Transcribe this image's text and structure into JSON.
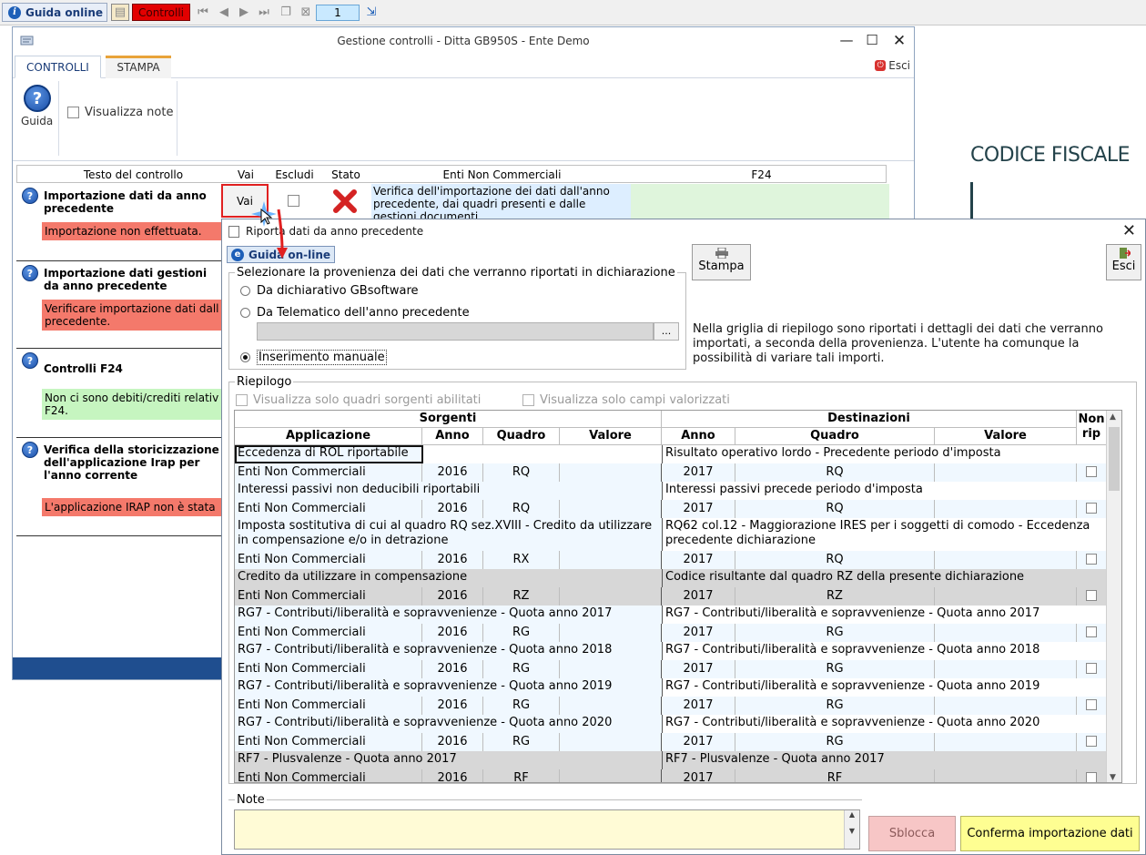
{
  "topbar": {
    "guida_label": "Guida online",
    "controlli_label": "Controlli",
    "page_number": "1"
  },
  "gestione": {
    "title": "Gestione controlli - Ditta GB950S - Ente Demo",
    "tab_controlli": "CONTROLLI",
    "tab_stampa": "STAMPA",
    "esci_label": "Esci",
    "guida_label": "Guida",
    "visualizza_note_label": "Visualizza note",
    "headers": {
      "testo": "Testo del controllo",
      "vai": "Vai",
      "escludi": "Escludi",
      "stato": "Stato",
      "enti": "Enti Non Commerciali",
      "f24": "F24"
    },
    "vai_label": "Vai",
    "enti_desc": "Verifica dell'importazione dei dati dall'anno precedente, dai quadri presenti e dalle gestioni documenti",
    "controls": [
      {
        "title": "Importazione dati da anno precedente",
        "message": "Importazione non effettuata."
      },
      {
        "title": "Importazione dati gestioni da anno precedente",
        "message": "Verificare importazione dati dall precedente."
      },
      {
        "title": "Controlli F24",
        "message": "Non ci sono debiti/crediti relativ F24."
      },
      {
        "title": "Verifica della storicizzazione dell'applicazione Irap per l'anno corrente",
        "message": "L'applicazione IRAP non è stata"
      }
    ]
  },
  "side_doc": {
    "codice_fiscale": "CODICE FISCALE"
  },
  "dialog": {
    "title": "Riporta dati da anno precedente",
    "guida_online_label": "Guida on-line",
    "stampa_label": "Stampa",
    "esci_label": "Esci",
    "provenienza_legend": "Selezionare la provenienza dei dati che verranno riportati in dichiarazione",
    "option_gbsoftware": "Da dichiarativo GBsoftware",
    "option_telematico": "Da Telematico dell'anno precedente",
    "option_manuale": "Inserimento manuale",
    "browse_label": "...",
    "info_text": "Nella griglia di riepilogo sono riportati i dettagli dei dati che verranno importati, a seconda della provenienza. L'utente ha comunque la possibilità di variare tali importi.",
    "riepilogo_legend": "Riepilogo",
    "opt_quadri_sorgenti": "Visualizza solo quadri sorgenti abilitati",
    "opt_campi_valorizzati": "Visualizza solo campi valorizzati",
    "note_legend": "Note",
    "sblocca_label": "Sblocca",
    "conferma_label": "Conferma importazione dati"
  },
  "grid": {
    "group_sorgenti": "Sorgenti",
    "group_destinazioni": "Destinazioni",
    "col_applicazione": "Applicazione",
    "col_anno": "Anno",
    "col_quadro": "Quadro",
    "col_valore": "Valore",
    "col_anno_dest": "Anno",
    "col_quadro_dest": "Quadro",
    "col_valore_dest": "Valore",
    "col_nonrip_1": "Non",
    "col_nonrip_2": "rip",
    "rows": [
      {
        "src": "Eccedenza di ROL riportabile",
        "dst": "Risultato operativo lordo - Precedente periodo d'imposta",
        "app": "Enti Non Commerciali",
        "anno": "2016",
        "quadro": "RQ",
        "anno_d": "2017",
        "quadro_d": "RQ",
        "gray": false
      },
      {
        "src": "Interessi passivi non deducibili riportabili",
        "dst": "Interessi passivi precede periodo d'imposta",
        "app": "Enti Non Commerciali",
        "anno": "2016",
        "quadro": "RQ",
        "anno_d": "2017",
        "quadro_d": "RQ",
        "gray": false
      },
      {
        "src": "Imposta sostitutiva di cui al quadro RQ sez.XVIII - Credito da utilizzare in compensazione e/o in detrazione",
        "dst": "RQ62 col.12 - Maggiorazione IRES per i soggetti di comodo - Eccedenza precedente dichiarazione",
        "app": "Enti Non Commerciali",
        "anno": "2016",
        "quadro": "RX",
        "anno_d": "2017",
        "quadro_d": "RQ",
        "gray": false
      },
      {
        "src": "Credito da utilizzare in compensazione",
        "dst": "Codice risultante dal quadro RZ della presente dichiarazione",
        "app": "Enti Non Commerciali",
        "anno": "2016",
        "quadro": "RZ",
        "anno_d": "2017",
        "quadro_d": "RZ",
        "gray": true
      },
      {
        "src": "RG7 - Contributi/liberalità e sopravvenienze - Quota anno 2017",
        "dst": "RG7 - Contributi/liberalità e sopravvenienze - Quota anno 2017",
        "app": "Enti Non Commerciali",
        "anno": "2016",
        "quadro": "RG",
        "anno_d": "2017",
        "quadro_d": "RG",
        "gray": false
      },
      {
        "src": "RG7 - Contributi/liberalità e sopravvenienze - Quota anno 2018",
        "dst": "RG7 - Contributi/liberalità e sopravvenienze - Quota anno 2018",
        "app": "Enti Non Commerciali",
        "anno": "2016",
        "quadro": "RG",
        "anno_d": "2017",
        "quadro_d": "RG",
        "gray": false
      },
      {
        "src": "RG7 - Contributi/liberalità e sopravvenienze - Quota anno 2019",
        "dst": "RG7 - Contributi/liberalità e sopravvenienze - Quota anno 2019",
        "app": "Enti Non Commerciali",
        "anno": "2016",
        "quadro": "RG",
        "anno_d": "2017",
        "quadro_d": "RG",
        "gray": false
      },
      {
        "src": "RG7 - Contributi/liberalità e sopravvenienze - Quota anno 2020",
        "dst": "RG7 - Contributi/liberalità e sopravvenienze - Quota anno 2020",
        "app": "Enti Non Commerciali",
        "anno": "2016",
        "quadro": "RG",
        "anno_d": "2017",
        "quadro_d": "RG",
        "gray": false
      },
      {
        "src": "RF7 - Plusvalenze  - Quota anno 2017",
        "dst": "RF7 - Plusvalenze  - Quota anno 2017",
        "app": "Enti Non Commerciali",
        "anno": "2016",
        "quadro": "RF",
        "anno_d": "2017",
        "quadro_d": "RF",
        "gray": true
      }
    ]
  }
}
